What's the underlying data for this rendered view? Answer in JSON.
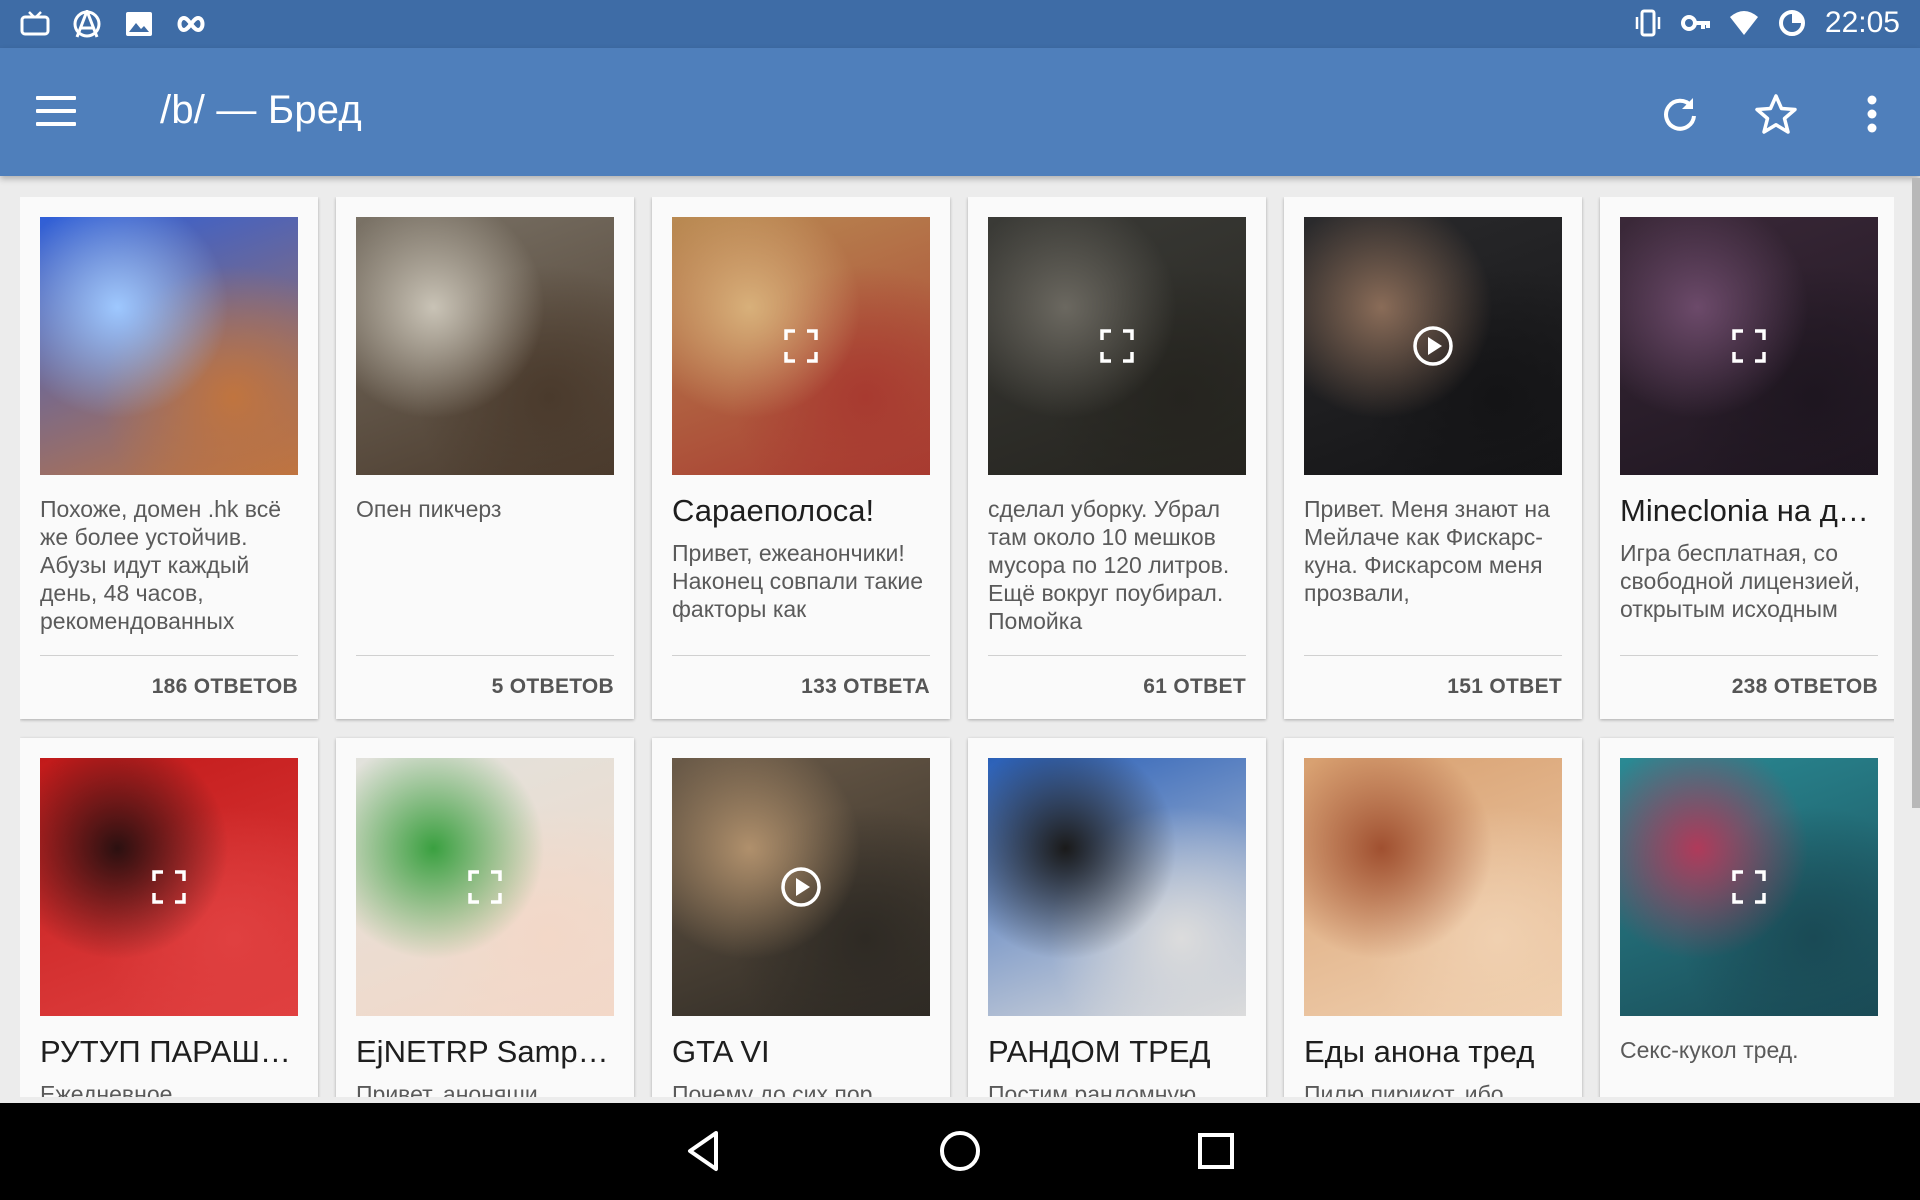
{
  "status": {
    "time": "22:05",
    "left_icons": [
      "tv-icon",
      "anarchy-icon",
      "image-icon",
      "infinity-icon"
    ],
    "right_icons": [
      "vibrate-icon",
      "key-icon",
      "wifi-icon",
      "sync-icon"
    ]
  },
  "appbar": {
    "title": "/b/ — Бред",
    "menu_icon": "hamburger-icon",
    "actions": [
      "refresh-icon",
      "star-icon",
      "more-vert-icon"
    ]
  },
  "colors": {
    "appbar": "#4f7fbb",
    "statusbar": "#3e6ca6",
    "background": "#ececec",
    "card": "#fafafa"
  },
  "threads": [
    {
      "heading": "",
      "snippet": "Похоже, домен .hk всё же более устойчив. Абузы идут каждый день, 48 часов, рекомендованных",
      "replies": "186 ОТВЕТОВ",
      "media": "image",
      "thumb_colors": [
        "#2f5fd8",
        "#9ec8ff",
        "#c0743f"
      ]
    },
    {
      "heading": "",
      "snippet": "Опен пикчерз",
      "replies": "5 ОТВЕТОВ",
      "media": "image",
      "thumb_colors": [
        "#7a7266",
        "#c9c3b6",
        "#4a3a2c"
      ]
    },
    {
      "heading": "Сараеполоса!",
      "snippet": "Привет, ежеанончики! Наконец совпали такие факторы как",
      "replies": "133 ОТВЕТА",
      "media": "gallery",
      "thumb_colors": [
        "#b98a52",
        "#d8b07a",
        "#a83a30"
      ]
    },
    {
      "heading": "",
      "snippet": "сделал уборку. Убрал там около 10 мешков мусора по 120 литров. Ещё вокруг поубирал. Помойка",
      "replies": "61 ОТВЕТ",
      "media": "gallery",
      "thumb_colors": [
        "#3a3a36",
        "#6b6860",
        "#25241f"
      ]
    },
    {
      "heading": "",
      "snippet": "Привет. Меня знают на Мейлаче как Фискарс-куна. Фискарсом меня прозвали,",
      "replies": "151 ОТВЕТ",
      "media": "video",
      "thumb_colors": [
        "#2a2a2c",
        "#8a6c58",
        "#141416"
      ]
    },
    {
      "heading": "Mineclonia на дв…",
      "snippet": "Игра бесплатная, со свободной лицензией, открытым исходным",
      "replies": "238 ОТВЕТОВ",
      "media": "gallery",
      "thumb_colors": [
        "#3a2838",
        "#6c4a6a",
        "#1e1620"
      ]
    },
    {
      "heading": "РУТУП ПАРАША…",
      "snippet": "Ежедневное",
      "replies": "",
      "media": "gallery",
      "thumb_colors": [
        "#c21a1a",
        "#2b1010",
        "#e04040"
      ]
    },
    {
      "heading": "EjNETRP Samp c…",
      "snippet": "Привет, аноняши",
      "replies": "",
      "media": "gallery",
      "thumb_colors": [
        "#e2e2dc",
        "#3aa040",
        "#f3d8c8"
      ]
    },
    {
      "heading": "GTA VI",
      "snippet": "Почему до сих пор",
      "replies": "",
      "media": "video",
      "thumb_colors": [
        "#6a5a48",
        "#b0906c",
        "#2e2a24"
      ]
    },
    {
      "heading": "РАНДОМ ТРЕД",
      "snippet": "Постим рандомную",
      "replies": "",
      "media": "image",
      "thumb_colors": [
        "#2a60b8",
        "#1a1a1a",
        "#dcdcdc"
      ]
    },
    {
      "heading": "Еды анона тред",
      "snippet": "Пилю пирикот, ибо",
      "replies": "",
      "media": "image",
      "thumb_colors": [
        "#d8a070",
        "#a05030",
        "#f0d0b0"
      ]
    },
    {
      "heading": "",
      "snippet": "Секс-кукол тред.",
      "replies": "",
      "media": "gallery",
      "thumb_colors": [
        "#2a8a94",
        "#b03a5a",
        "#1a4a55"
      ]
    }
  ],
  "navbar": {
    "buttons": [
      "back-icon",
      "home-icon",
      "recents-icon"
    ]
  }
}
